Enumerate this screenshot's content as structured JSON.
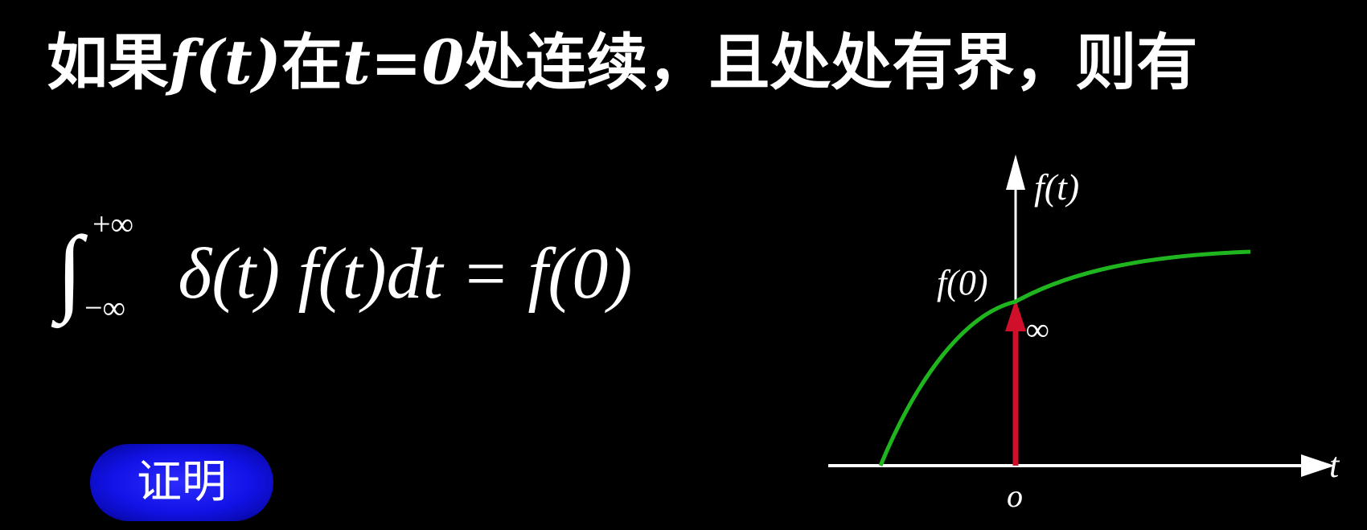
{
  "slide": {
    "heading": {
      "part1": "如果",
      "f_t": "f(t)",
      "part2": "在",
      "t_eq": "t=0",
      "part3": "处连续，且处处有界，则有"
    },
    "formula": {
      "integral": "∫",
      "upper_limit": "+∞",
      "lower_limit": "−∞",
      "body": "δ(t) f(t)dt = f(0)"
    },
    "prove_button": "证明",
    "graph": {
      "y_axis_label": "f(t)",
      "x_axis_label": "t",
      "origin_label": "o",
      "f0_label": "f(0)",
      "infinity_label": "∞",
      "curve_color": "#1fb51f",
      "impulse_color": "#d0102a"
    }
  }
}
